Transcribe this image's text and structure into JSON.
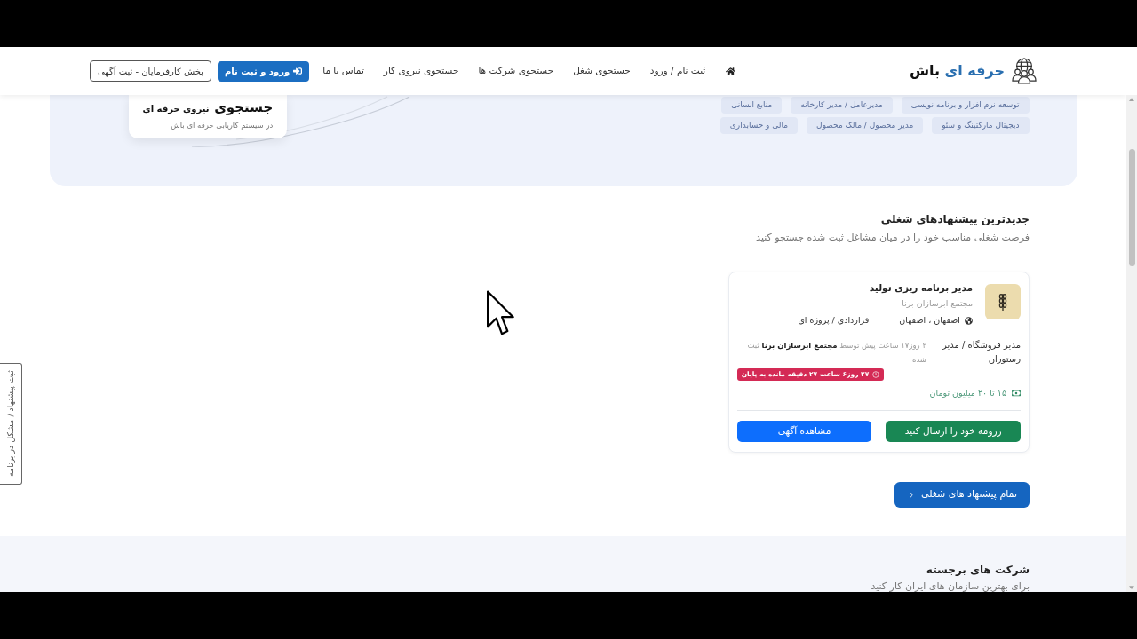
{
  "header": {
    "logo": {
      "accent": "حرفه ای",
      "rest": "باش"
    },
    "nav": [
      "ثبت نام / ورود",
      "جستجوی شغل",
      "جستجوی شرکت ها",
      "جستجوی نیروی کار",
      "تماس با ما"
    ],
    "login_button": "ورود و ثبت نام",
    "employer_button": "بخش کارفرمایان - ثبت آگهی"
  },
  "hero": {
    "tag_rows": [
      {
        "tags": [
          "توسعه نرم افزار و برنامه نویسی",
          "مدیرعامل / مدیر کارخانه",
          "منابع انسانی"
        ]
      },
      {
        "tags": [
          "دیجیتال مارکتینگ و سئو",
          "مدیر محصول / مالک محصول",
          "مالی و حسابداری"
        ]
      }
    ],
    "card": {
      "title_big": "جستجوی",
      "title_rest": "نیروی حرفه ای",
      "subtitle": "در سیستم کاریابی حرفه ای باش"
    }
  },
  "latest_jobs": {
    "title": "جدیدترین پیشنهادهای شغلی",
    "subtitle": "فرصت شغلی مناسب خود را در میان مشاغل ثبت شده جستجو کنید",
    "jobs": [
      {
        "title": "مدیر برنامه ریزی تولید",
        "company": "مجتمع ابرسازان برنا",
        "location": "اصفهان ، اصفهان",
        "contract": "قراردادی / پروژه ای",
        "category": "مدیر فروشگاه / مدیر رستوران",
        "posted": "۲ روز۱۷ ساعت پیش توسط **مجتمع ابرسازان برنا** ثبت شده",
        "deadline": "۲۷ روز۶ ساعت ۲۷ دقیقه مانده به پایان",
        "salary": "۱۵ تا ۲۰ میلیون تومان",
        "apply_button": "رزومه خود را ارسال کنید",
        "view_button": "مشاهده آگهی"
      }
    ],
    "all_button": "تمام پیشنهاد های شغلی"
  },
  "featured_companies": {
    "title": "شرکت های برجسته",
    "subtitle": "برای بهترین سازمان های ایران کار کنید"
  },
  "feedback_tab": "ثبت پیشنهاد / مشکل در برنامه"
}
